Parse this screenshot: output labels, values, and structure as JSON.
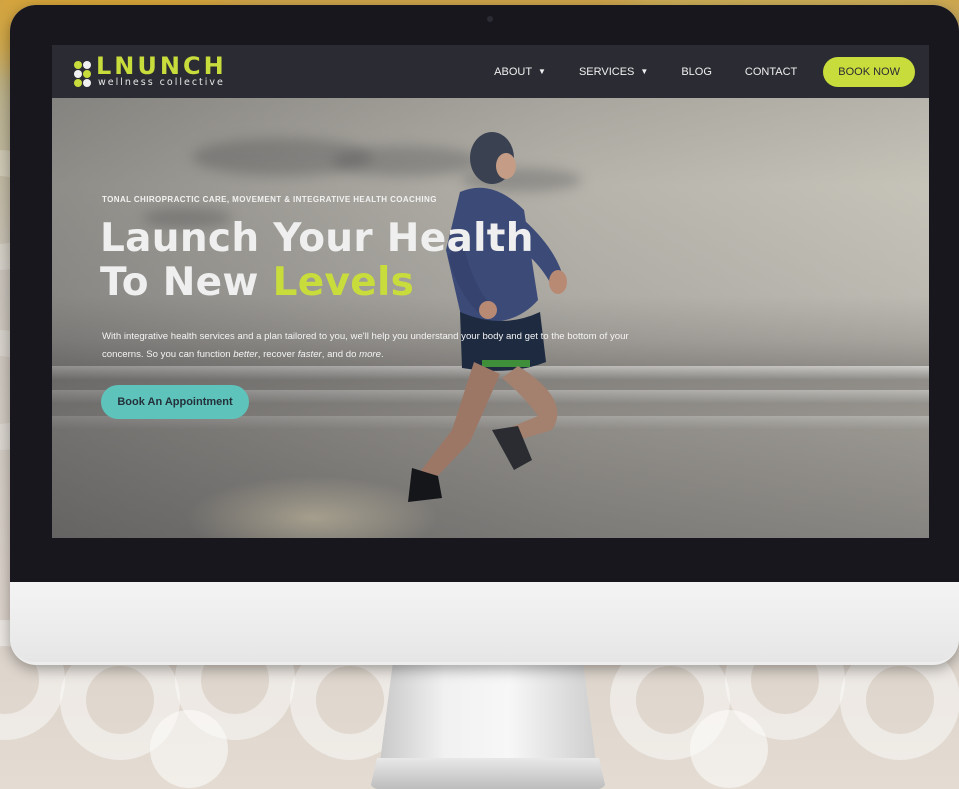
{
  "logo": {
    "title": "LNUNCH",
    "subtitle": "wellness collective",
    "colors": {
      "lime": "#c8dc3c",
      "teal": "#5ec4bb",
      "dark": "#2b2b33"
    }
  },
  "nav": {
    "about": "ABOUT",
    "services": "SERVICES",
    "blog": "BLOG",
    "contact": "CONTACT",
    "book_now": "BOOK NOW",
    "caret_icon": "chevron-down-icon"
  },
  "hero": {
    "kicker": "TONAL CHIROPRACTIC CARE, MOVEMENT & INTEGRATIVE HEALTH COACHING",
    "headline_line1": "Launch Your Health",
    "headline_line2_prefix": "To New ",
    "headline_line2_accent": "Levels",
    "body_part1": "With integrative health services and a plan tailored to you, we'll help you understand your body and get to the bottom of your concerns. So you can function ",
    "body_em1": "better",
    "body_part2": ", recover ",
    "body_em2": "faster",
    "body_part3": ", and do ",
    "body_em3": "more",
    "body_part4": ".",
    "cta_label": "Book An Appointment",
    "image_subject": "runner on beach at dawn"
  }
}
